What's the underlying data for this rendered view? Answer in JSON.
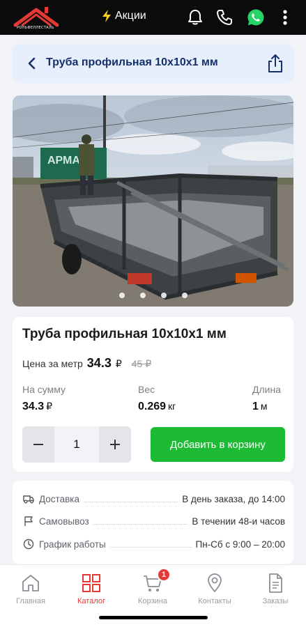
{
  "brand": {
    "logo_text": "РОЛЬФЕЛЛЕСТАЛЬ",
    "brand_color": "#e53935"
  },
  "topbar": {
    "promo_label": "Акции",
    "icons": [
      "bell-icon",
      "phone-icon",
      "whatsapp-icon",
      "more-vertical-icon"
    ]
  },
  "header": {
    "title": "Труба профильная 10х10х1 мм"
  },
  "gallery": {
    "slides_count": 4,
    "active_slide": 1,
    "photo_sign_text": "АРМА"
  },
  "product": {
    "title": "Труба профильная 10х10х1 мм",
    "price_label": "Цена за метр",
    "price": "34.3",
    "currency": "₽",
    "old_price": "45 ₽",
    "stats": {
      "sum": {
        "label": "На сумму",
        "value": "34.3",
        "unit": "₽"
      },
      "weight": {
        "label": "Вес",
        "value": "0.269",
        "unit": "кг"
      },
      "length": {
        "label": "Длина",
        "value": "1",
        "unit": "м"
      }
    },
    "quantity": "1",
    "add_to_cart_label": "Добавить в корзину"
  },
  "info": [
    {
      "icon": "truck-icon",
      "label": "Доставка",
      "value": "В день заказа, до 14:00"
    },
    {
      "icon": "flag-icon",
      "label": "Самовывоз",
      "value": "В течении 48-и часов"
    },
    {
      "icon": "clock-icon",
      "label": "График работы",
      "value": "Пн-Сб с 9:00 – 20:00"
    }
  ],
  "nav": {
    "items": [
      {
        "label": "Главная",
        "icon": "home-icon",
        "active": false
      },
      {
        "label": "Каталог",
        "icon": "grid-icon",
        "active": true
      },
      {
        "label": "Корзина",
        "icon": "cart-icon",
        "active": false,
        "badge": "1"
      },
      {
        "label": "Контакты",
        "icon": "map-pin-icon",
        "active": false
      },
      {
        "label": "Заказы",
        "icon": "document-icon",
        "active": false
      }
    ]
  },
  "colors": {
    "accent_green": "#1dba34",
    "header_bg": "#e7eefc",
    "header_text": "#14306b",
    "badge": "#e53935"
  }
}
